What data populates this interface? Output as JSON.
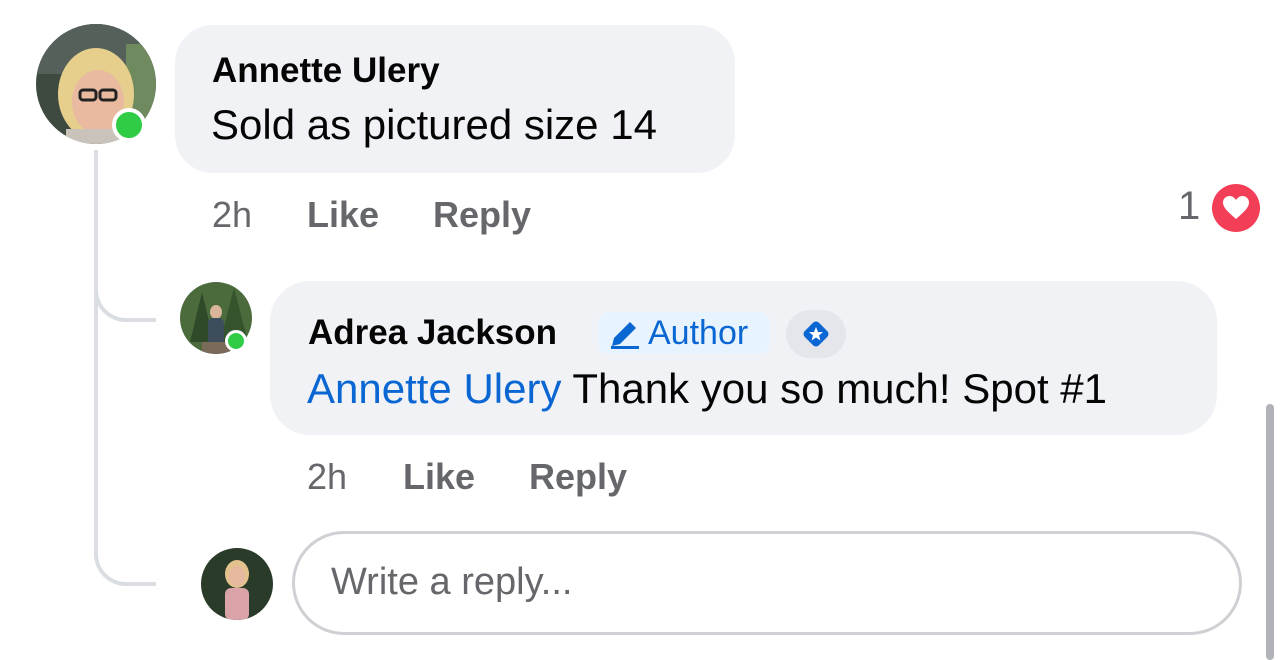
{
  "comment": {
    "author": "Annette Ulery",
    "text": "Sold as pictured size 14",
    "time": "2h",
    "like_label": "Like",
    "reply_label": "Reply",
    "reaction_count": "1",
    "reaction_icon": "heart-icon"
  },
  "reply": {
    "author": "Adrea Jackson",
    "author_badge": "Author",
    "mention": "Annette Ulery",
    "text": " Thank you so much! Spot #1",
    "time": "2h",
    "like_label": "Like",
    "reply_label": "Reply"
  },
  "composer": {
    "placeholder": "Write a reply..."
  },
  "colors": {
    "bubble": "#f0f2f5",
    "link": "#0a66d2",
    "online": "#31cc46",
    "heart": "#f33e58",
    "meta": "#65676b"
  }
}
